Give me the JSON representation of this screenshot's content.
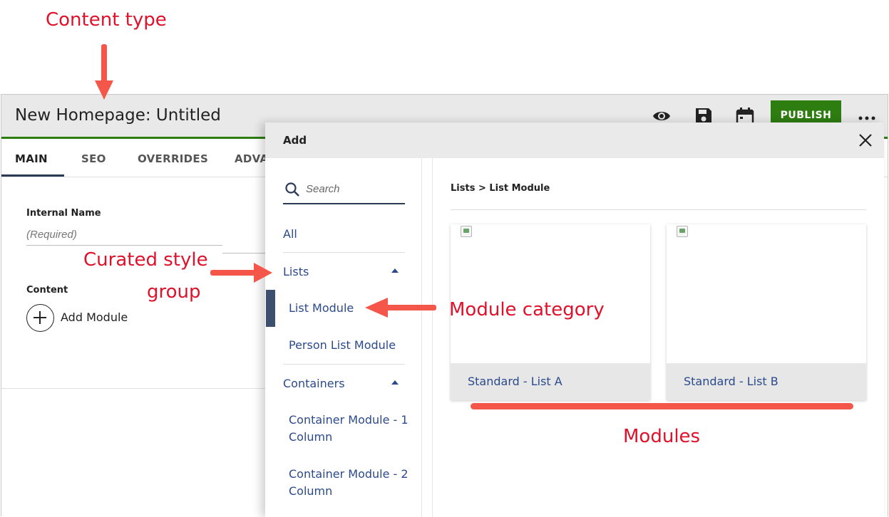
{
  "annotations": {
    "content_type": "Content type",
    "curated_style_line1": "Curated style",
    "curated_style_line2": "group",
    "module_category": "Module category",
    "modules": "Modules"
  },
  "editor": {
    "title": "New Homepage: Untitled",
    "publish_label": "PUBLISH",
    "icons": [
      "eye-icon",
      "save-icon",
      "calendar-icon",
      "more-icon"
    ],
    "tabs": [
      {
        "label": "MAIN",
        "active": true
      },
      {
        "label": "SEO"
      },
      {
        "label": "OVERRIDES"
      },
      {
        "label": "ADVA"
      }
    ],
    "internal_name_label": "Internal Name",
    "internal_name_placeholder": "(Required)",
    "content_label": "Content",
    "add_module_label": "Add Module",
    "accent_color": "#2e7d11"
  },
  "dialog": {
    "title": "Add",
    "search_placeholder": "Search",
    "nav": {
      "all": "All",
      "lists": "Lists",
      "list_module": "List Module",
      "person_list_module": "Person List Module",
      "containers": "Containers",
      "container_1": "Container Module - 1 Column",
      "container_2": "Container Module - 2 Column"
    },
    "breadcrumb": "Lists > List Module",
    "modules": [
      {
        "label": "Standard - List A"
      },
      {
        "label": "Standard - List B"
      }
    ]
  }
}
